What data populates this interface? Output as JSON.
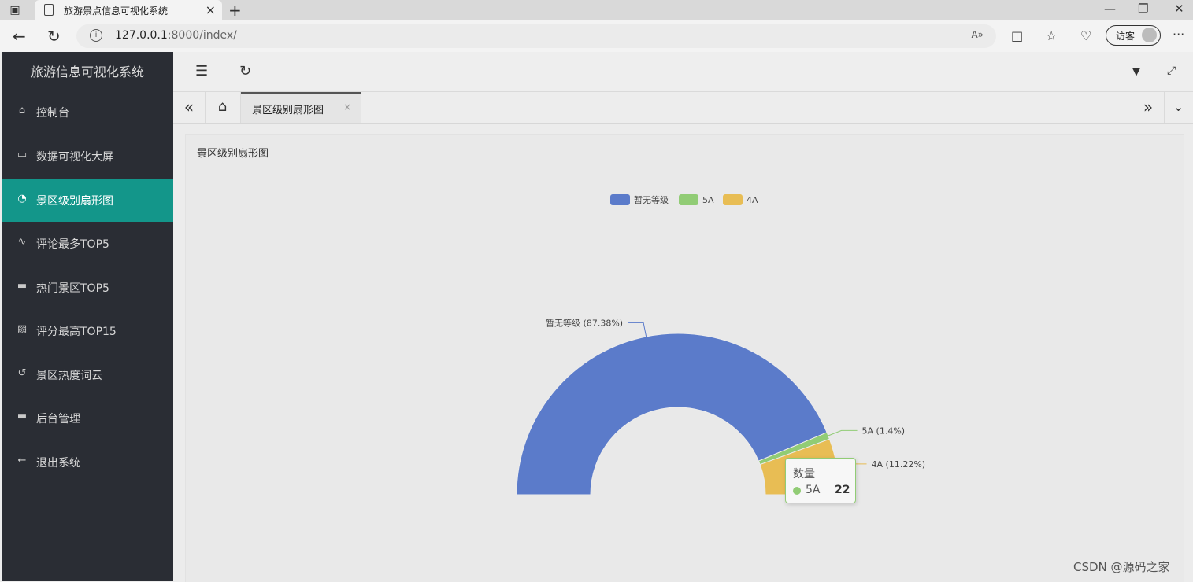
{
  "browser": {
    "tab_title": "旅游景点信息可视化系统",
    "url_host": "127.0.0.1",
    "url_rest": ":8000/index/",
    "guest_label": "访客"
  },
  "sidebar": {
    "logo": "旅游信息可视化系统",
    "items": [
      {
        "label": "控制台",
        "icon": "home-icon"
      },
      {
        "label": "数据可视化大屏",
        "icon": "window-icon"
      },
      {
        "label": "景区级别扇形图",
        "icon": "gauge-icon",
        "active": true
      },
      {
        "label": "评论最多TOP5",
        "icon": "pulse-icon"
      },
      {
        "label": "热门景区TOP5",
        "icon": "monitor-icon"
      },
      {
        "label": "评分最高TOP15",
        "icon": "image-icon"
      },
      {
        "label": "景区热度词云",
        "icon": "refresh-icon"
      },
      {
        "label": "后台管理",
        "icon": "monitor-icon"
      },
      {
        "label": "退出系统",
        "icon": "arrow-left-icon"
      }
    ]
  },
  "tabs": {
    "current": "景区级别扇形图"
  },
  "card": {
    "title": "景区级别扇形图"
  },
  "chart_data": {
    "type": "pie",
    "variant": "half-donut",
    "series_name": "数量",
    "legend": [
      "暂无等级",
      "5A",
      "4A"
    ],
    "slices": [
      {
        "name": "暂无等级",
        "percent": 87.38,
        "label": "暂无等级 (87.38%)",
        "color": "#5b7bca"
      },
      {
        "name": "5A",
        "percent": 1.4,
        "label": "5A (1.4%)",
        "color": "#91cc75"
      },
      {
        "name": "4A",
        "percent": 11.22,
        "label": "4A (11.22%)",
        "color": "#e8bd54"
      }
    ]
  },
  "tooltip": {
    "title": "数量",
    "name": "5A",
    "value": "22"
  },
  "watermark": "CSDN @源码之家"
}
